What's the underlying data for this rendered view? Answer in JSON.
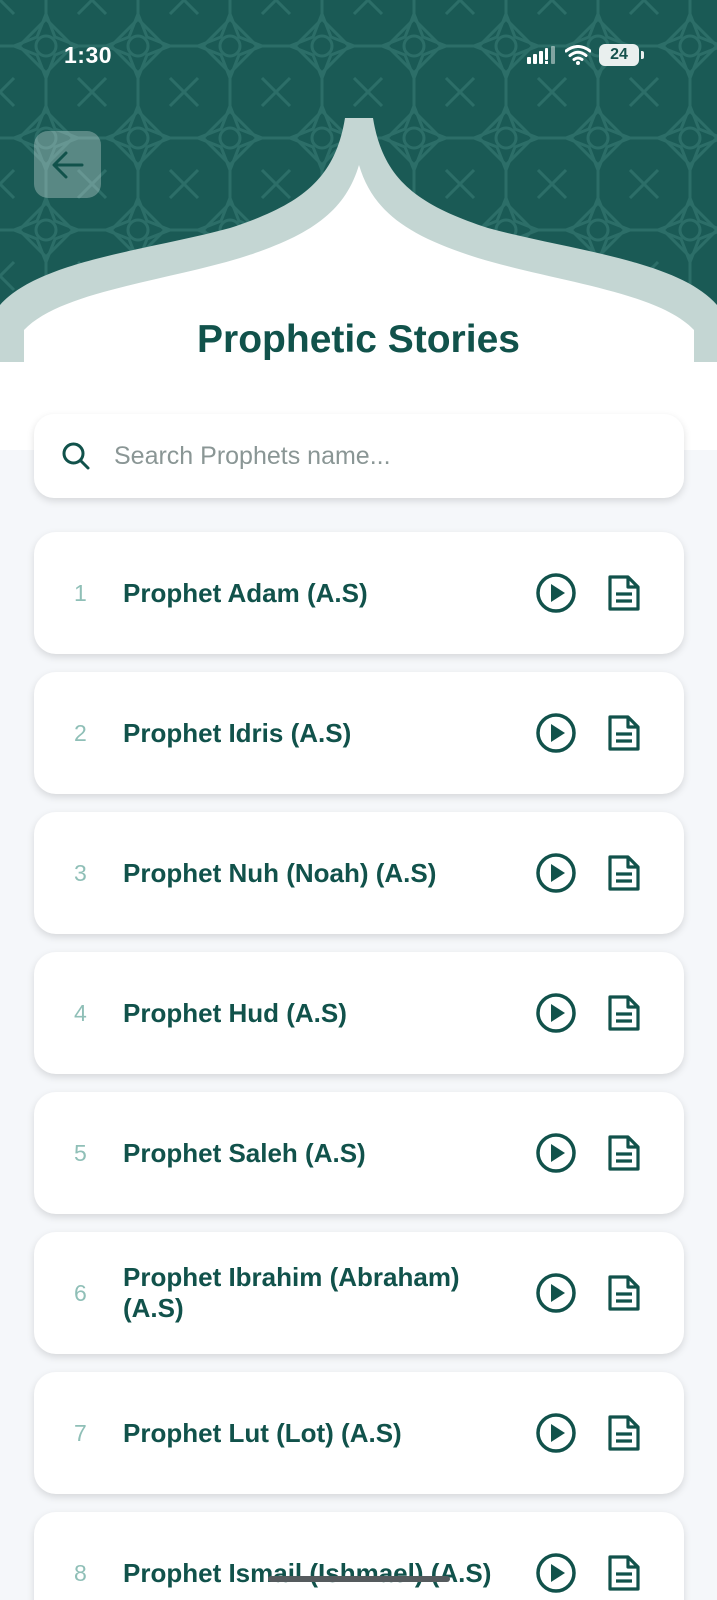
{
  "status_bar": {
    "time": "1:30",
    "battery": "24"
  },
  "header": {
    "title": "Prophetic Stories",
    "pattern_color": "#1a5a55",
    "accent": "#11524b"
  },
  "search": {
    "placeholder": "Search Prophets name..."
  },
  "prophets": [
    {
      "number": "1",
      "name": "Prophet Adam (A.S)"
    },
    {
      "number": "2",
      "name": "Prophet Idris (A.S)"
    },
    {
      "number": "3",
      "name": "Prophet Nuh (Noah) (A.S)"
    },
    {
      "number": "4",
      "name": "Prophet Hud (A.S)"
    },
    {
      "number": "5",
      "name": "Prophet Saleh (A.S)"
    },
    {
      "number": "6",
      "name": "Prophet Ibrahim (Abraham) (A.S)"
    },
    {
      "number": "7",
      "name": "Prophet Lut (Lot) (A.S)"
    },
    {
      "number": "8",
      "name": "Prophet Ismail (Ishmael) (A.S)"
    }
  ],
  "icons": {
    "back": "arrow-left-icon",
    "search": "search-icon",
    "play": "play-circle-icon",
    "document": "document-icon"
  }
}
